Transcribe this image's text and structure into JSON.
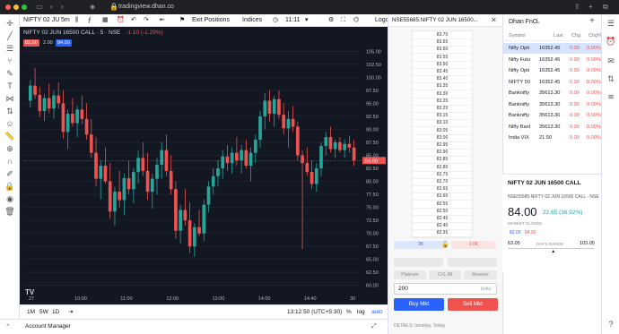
{
  "browser": {
    "url": "tradingview.dhan.co",
    "colors": {
      "close": "#ff5f57",
      "min": "#febc2e",
      "max": "#28c840"
    }
  },
  "toolbar": {
    "symbol": "NIFTY 02 JU",
    "interval": "5m",
    "exit_positions": "Exit Positions",
    "indices": "Indices",
    "time": "11:11",
    "logo": "Logo"
  },
  "chart": {
    "title": "NIFTY 02 JUN 16500 CALL · 5 · NSE",
    "change": "-1.10 (-1.29%)",
    "badges": {
      "sell": "82.00",
      "spread": "2.00",
      "buy": "84.00"
    },
    "last_price_label": "84.00",
    "tv_logo": "TV"
  },
  "bottom_bar": {
    "ranges": [
      "1M",
      "5W",
      "1D"
    ],
    "clock": "13:12:50 (UTC+5:30)",
    "pct": "%",
    "log": "log",
    "auto": "auto"
  },
  "account_manager": {
    "label": "Account Manager"
  },
  "ladder": {
    "title": "NSE55685:NIFTY 02 JUN 16500...",
    "prices": [
      "83.70",
      "83.65",
      "83.60",
      "83.55",
      "83.50",
      "83.45",
      "83.40",
      "83.35",
      "83.30",
      "83.25",
      "83.20",
      "83.15",
      "83.10",
      "83.05",
      "83.00",
      "82.95",
      "82.90",
      "82.85",
      "82.80",
      "82.75",
      "82.70",
      "82.65",
      "82.60",
      "82.55",
      "82.50",
      "82.45",
      "82.40",
      "82.35"
    ],
    "bid_qty": "2K",
    "ask_qty": "2.6K",
    "order_types": [
      "Platinum",
      "CXL All",
      "Reverse"
    ],
    "qty_value": "200",
    "qty_unit": "Units",
    "buy_label": "Buy Mkt",
    "sell_label": "Sell Mkt",
    "details": "DETAILS: Intraday, Today",
    "colors": {
      "buy": "#2962ff",
      "sell": "#ef5350"
    }
  },
  "watchlist": {
    "title": "Dhan FnO",
    "headers": [
      "Symbol",
      "Last",
      "Chg",
      "Chg%"
    ],
    "rows": [
      {
        "symbol": "Nifty Opti",
        "last": "16352.45",
        "chg": "0.00",
        "chgp": "0.00%",
        "selected": true
      },
      {
        "symbol": "Nifty Futu",
        "last": "16352.45",
        "chg": "0.00",
        "chgp": "0.00%",
        "selected": false
      },
      {
        "symbol": "Nifty Opti",
        "last": "16352.45",
        "chg": "0.00",
        "chgp": "0.00%",
        "selected": false
      },
      {
        "symbol": "NIFTY 50",
        "last": "16352.45",
        "chg": "0.00",
        "chgp": "0.00%",
        "selected": false
      },
      {
        "symbol": "Banknifty",
        "last": "35613.30",
        "chg": "0.00",
        "chgp": "0.00%",
        "selected": false
      },
      {
        "symbol": "Banknifty",
        "last": "35613.30",
        "chg": "0.00",
        "chgp": "0.00%",
        "selected": false
      },
      {
        "symbol": "Banknifty",
        "last": "35613.30",
        "chg": "0.00",
        "chgp": "0.00%",
        "selected": false
      },
      {
        "symbol": "Nifty Banl",
        "last": "35613.30",
        "chg": "0.00",
        "chgp": "0.00%",
        "selected": false
      },
      {
        "symbol": "India VIX",
        "last": "21.50",
        "chg": "0.00",
        "chgp": "0.00%",
        "selected": false
      }
    ]
  },
  "detail": {
    "name": "NIFTY 02 JUN 16500 CALL",
    "exchange": "NSE55685:NIFTY 02 JUN 16500 CALL · NSE",
    "price": "84.00",
    "change": "22.65 (36.92%)",
    "status": "MARKET CLOSED",
    "bid": "82.00",
    "ask": "84.00",
    "low": "63.05",
    "range_label": "DAY'S RANGE",
    "high": "103.05"
  },
  "chart_data": {
    "type": "candlestick",
    "x_ticks": [
      "27",
      "10:00",
      "11:00",
      "12:00",
      "13:00",
      "14:00",
      "14:40",
      "30"
    ],
    "y_ticks": [
      "105.00",
      "102.50",
      "100.00",
      "97.50",
      "95.00",
      "92.50",
      "90.00",
      "87.50",
      "85.00",
      "82.50",
      "80.00",
      "77.50",
      "75.00",
      "72.50",
      "70.00",
      "67.50",
      "65.00",
      "62.50",
      "60.00"
    ],
    "ylim": [
      58.75,
      106.25
    ],
    "colors": {
      "up": "#26a69a",
      "down": "#ef5350"
    },
    "candles": [
      [
        95.5,
        99.5,
        94.2,
        98.4
      ],
      [
        98.4,
        101.8,
        95.8,
        96.6
      ],
      [
        96.6,
        98.2,
        92.4,
        93.5
      ],
      [
        93.5,
        96.8,
        91.6,
        96.0
      ],
      [
        96.0,
        98.8,
        93.1,
        94.0
      ],
      [
        94.0,
        97.5,
        92.0,
        96.5
      ],
      [
        96.5,
        99.0,
        94.0,
        95.0
      ],
      [
        95.0,
        97.5,
        88.2,
        89.5
      ],
      [
        89.5,
        93.8,
        86.2,
        93.0
      ],
      [
        93.0,
        96.0,
        90.5,
        91.2
      ],
      [
        91.2,
        94.5,
        88.5,
        93.8
      ],
      [
        93.8,
        96.5,
        91.0,
        92.0
      ],
      [
        92.0,
        95.0,
        88.0,
        89.0
      ],
      [
        89.0,
        92.0,
        84.5,
        85.5
      ],
      [
        85.5,
        88.5,
        79.0,
        80.5
      ],
      [
        80.5,
        84.0,
        76.5,
        83.0
      ],
      [
        83.0,
        86.5,
        79.5,
        80.0
      ],
      [
        80.0,
        83.5,
        72.8,
        74.2
      ],
      [
        74.2,
        79.0,
        71.5,
        78.0
      ],
      [
        78.0,
        82.0,
        75.0,
        76.4
      ],
      [
        76.4,
        81.5,
        73.5,
        80.6
      ],
      [
        80.6,
        84.0,
        77.5,
        78.5
      ],
      [
        78.5,
        82.5,
        75.8,
        81.8
      ],
      [
        81.8,
        86.0,
        79.5,
        84.5
      ],
      [
        84.5,
        87.5,
        81.0,
        82.0
      ],
      [
        82.0,
        85.5,
        76.5,
        78.0
      ],
      [
        78.0,
        81.5,
        74.8,
        80.5
      ],
      [
        80.5,
        84.5,
        77.5,
        83.2
      ],
      [
        83.2,
        87.5,
        80.5,
        86.0
      ],
      [
        86.0,
        89.0,
        81.0,
        82.0
      ],
      [
        82.0,
        85.0,
        77.5,
        78.5
      ],
      [
        78.5,
        80.0,
        69.0,
        70.5
      ],
      [
        70.5,
        75.5,
        68.0,
        74.5
      ],
      [
        74.5,
        78.5,
        71.5,
        72.5
      ],
      [
        72.5,
        76.0,
        66.2,
        67.5
      ],
      [
        67.5,
        72.0,
        65.5,
        71.2
      ],
      [
        71.2,
        74.5,
        69.5,
        70.0
      ],
      [
        70.0,
        76.5,
        68.5,
        75.5
      ],
      [
        75.5,
        80.0,
        74.0,
        79.0
      ],
      [
        79.0,
        82.5,
        77.5,
        81.0
      ],
      [
        81.0,
        84.0,
        79.0,
        82.5
      ],
      [
        82.5,
        86.0,
        80.5,
        84.8
      ],
      [
        84.8,
        87.0,
        82.0,
        83.5
      ],
      [
        83.5,
        86.5,
        81.5,
        85.5
      ],
      [
        85.5,
        88.5,
        83.0,
        84.0
      ],
      [
        84.0,
        87.0,
        81.5,
        86.0
      ],
      [
        86.0,
        88.0,
        82.5,
        83.0
      ],
      [
        83.0,
        86.5,
        80.0,
        85.5
      ],
      [
        85.5,
        89.0,
        83.5,
        88.0
      ],
      [
        88.0,
        93.5,
        86.5,
        92.5
      ],
      [
        92.5,
        97.0,
        90.0,
        95.5
      ],
      [
        95.5,
        97.5,
        91.5,
        93.0
      ],
      [
        93.0,
        96.5,
        90.5,
        95.8
      ],
      [
        95.8,
        97.5,
        92.0,
        92.8
      ],
      [
        92.8,
        95.0,
        89.0,
        90.2
      ],
      [
        90.2,
        93.5,
        86.5,
        92.0
      ],
      [
        92.0,
        94.5,
        89.5,
        90.5
      ],
      [
        90.5,
        91.5,
        84.0,
        85.0
      ],
      [
        85.0,
        86.0,
        67.0,
        83.5
      ],
      [
        83.5,
        86.5,
        81.0,
        81.8
      ],
      [
        81.8,
        84.0,
        78.5,
        79.5
      ],
      [
        79.5,
        83.5,
        78.0,
        82.5
      ],
      [
        82.5,
        87.5,
        81.0,
        86.8
      ],
      [
        86.8,
        89.5,
        85.0,
        88.5
      ],
      [
        88.5,
        90.5,
        85.5,
        86.2
      ],
      [
        86.2,
        88.0,
        84.5,
        87.5
      ],
      [
        87.5,
        88.5,
        85.5,
        86.0
      ],
      [
        86.0,
        88.0,
        84.5,
        87.2
      ],
      [
        87.2,
        88.8,
        85.5,
        86.5
      ],
      [
        86.5,
        88.0,
        83.0,
        84.0
      ]
    ]
  }
}
